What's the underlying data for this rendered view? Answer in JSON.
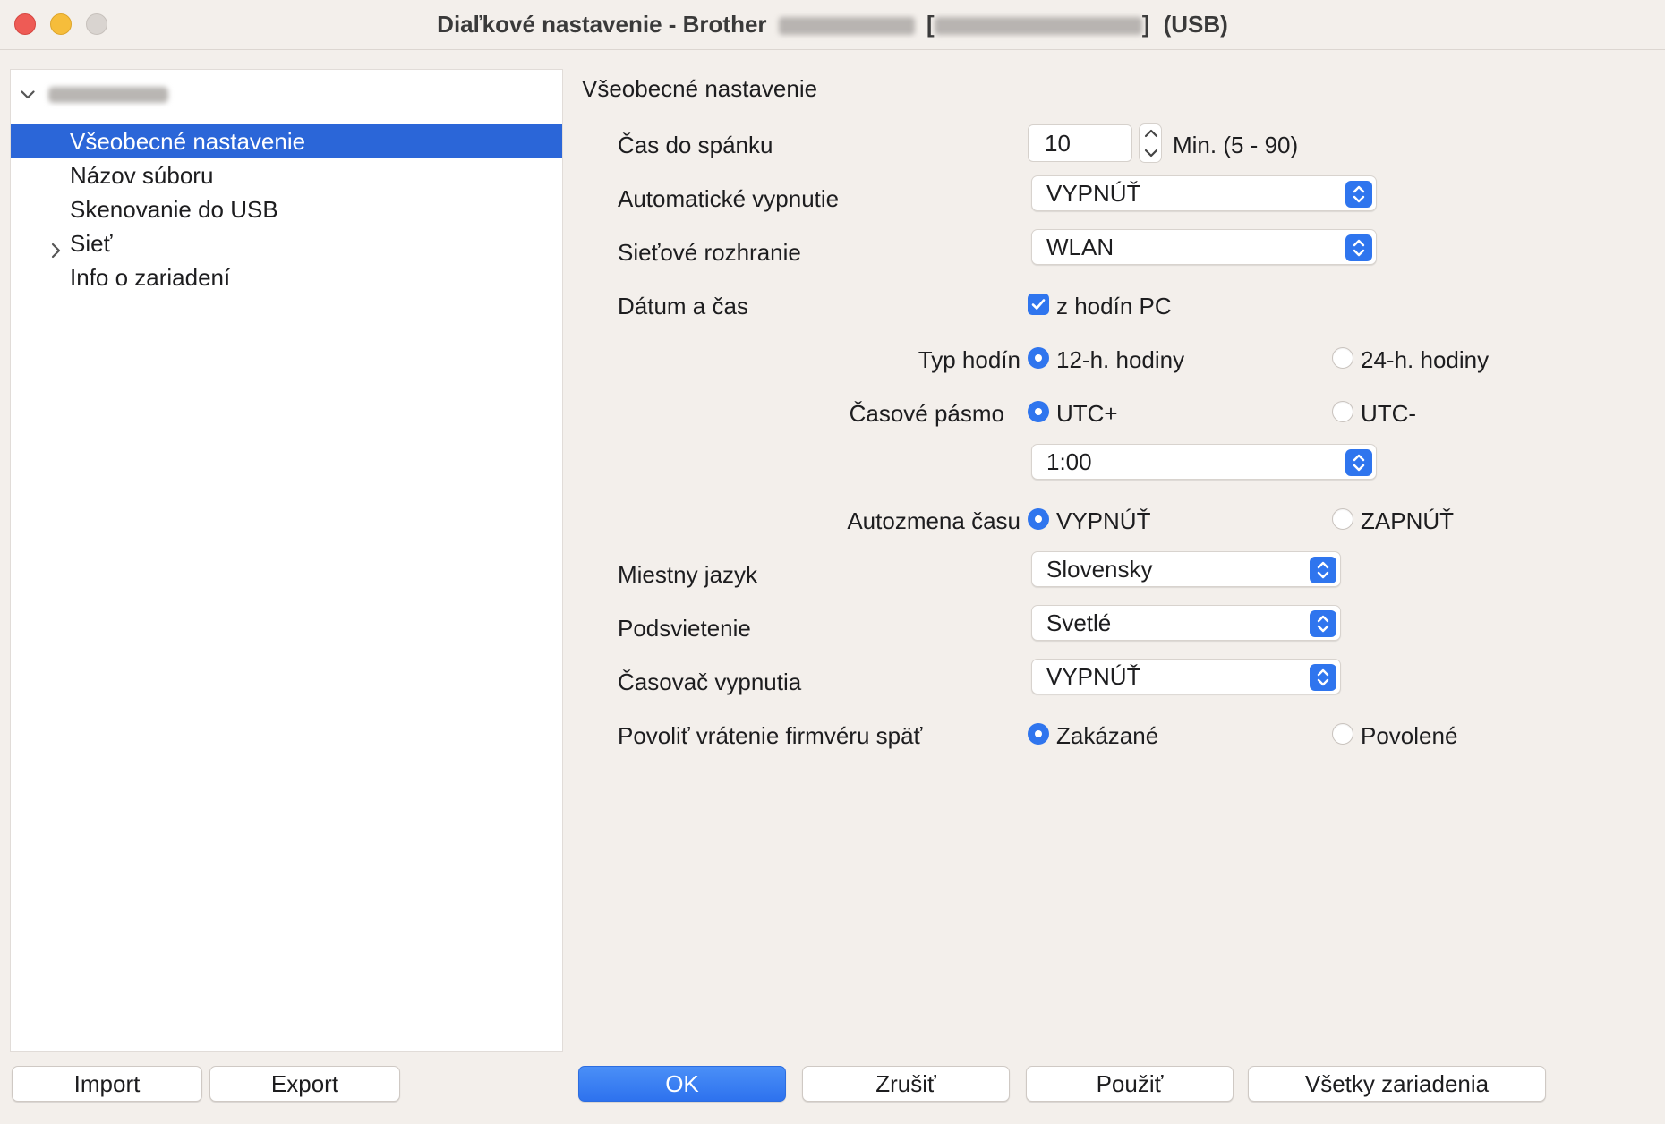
{
  "window": {
    "title_prefix": "Diaľkové nastavenie - Brother",
    "title_open_bracket": "[",
    "title_close_bracket": "]",
    "title_suffix": "(USB)"
  },
  "sidebar": {
    "items": [
      {
        "label": "Všeobecné nastavenie"
      },
      {
        "label": "Názov súboru"
      },
      {
        "label": "Skenovanie do USB"
      },
      {
        "label": "Sieť"
      },
      {
        "label": "Info o zariadení"
      }
    ]
  },
  "panel": {
    "title": "Všeobecné nastavenie",
    "sleep_time": {
      "label": "Čas do spánku",
      "value": "10",
      "range": "Min. (5 - 90)"
    },
    "auto_off": {
      "label": "Automatické vypnutie",
      "value": "VYPNÚŤ"
    },
    "network_interface": {
      "label": "Sieťové rozhranie",
      "value": "WLAN"
    },
    "date_time": {
      "label": "Dátum a čas",
      "checkbox_label": "z hodín PC",
      "checked": true
    },
    "clock_type": {
      "label": "Typ hodín",
      "option1": "12-h. hodiny",
      "option2": "24-h. hodiny",
      "selected": "12-h. hodiny"
    },
    "time_zone": {
      "label": "Časové pásmo",
      "option1": "UTC+",
      "option2": "UTC-",
      "selected": "UTC+",
      "offset": "1:00"
    },
    "auto_daylight": {
      "label": "Autozmena času",
      "option1": "VYPNÚŤ",
      "option2": "ZAPNÚŤ",
      "selected": "VYPNÚŤ"
    },
    "local_language": {
      "label": "Miestny jazyk",
      "value": "Slovensky"
    },
    "backlight": {
      "label": "Podsvietenie",
      "value": "Svetlé"
    },
    "off_timer": {
      "label": "Časovač vypnutia",
      "value": "VYPNÚŤ"
    },
    "firmware_rollback": {
      "label": "Povoliť vrátenie firmvéru späť",
      "option1": "Zakázané",
      "option2": "Povolené",
      "selected": "Zakázané"
    }
  },
  "buttons": {
    "import": "Import",
    "export": "Export",
    "ok": "OK",
    "cancel": "Zrušiť",
    "apply": "Použiť",
    "all_devices": "Všetky zariadenia"
  },
  "colors": {
    "accent": "#2f75ee",
    "selection": "#2b66d8",
    "window_bg": "#f3efeb"
  }
}
